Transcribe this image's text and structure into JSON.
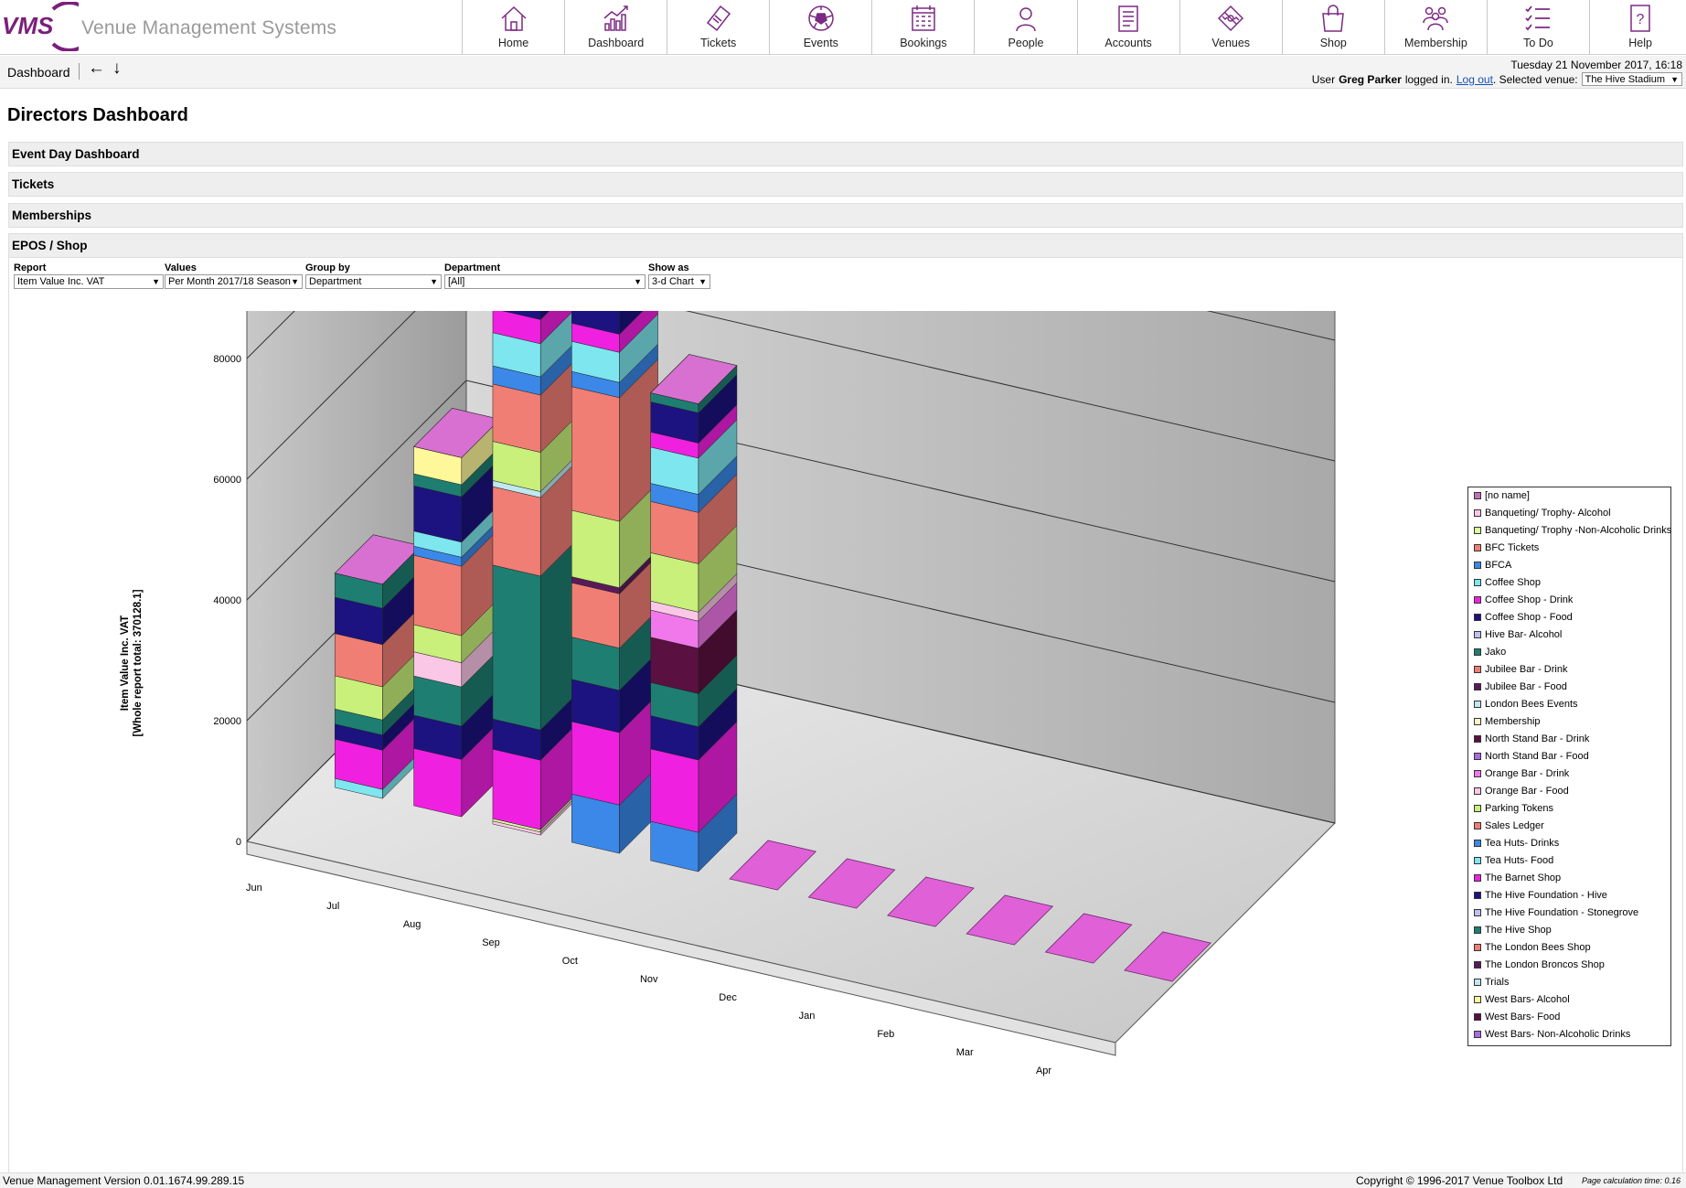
{
  "header": {
    "logo_text": "VMS",
    "title": "Venue Management Systems",
    "nav": [
      {
        "label": "Home",
        "icon": "home-icon"
      },
      {
        "label": "Dashboard",
        "icon": "dashboard-chart-icon"
      },
      {
        "label": "Tickets",
        "icon": "ticket-icon"
      },
      {
        "label": "Events",
        "icon": "football-icon"
      },
      {
        "label": "Bookings",
        "icon": "calendar-icon"
      },
      {
        "label": "People",
        "icon": "person-icon"
      },
      {
        "label": "Accounts",
        "icon": "document-icon"
      },
      {
        "label": "Venues",
        "icon": "pitch-icon"
      },
      {
        "label": "Shop",
        "icon": "shopping-bag-icon"
      },
      {
        "label": "Membership",
        "icon": "group-icon"
      },
      {
        "label": "To Do",
        "icon": "checklist-icon"
      },
      {
        "label": "Help",
        "icon": "help-icon"
      }
    ]
  },
  "crumbbar": {
    "breadcrumb": "Dashboard",
    "back": "←",
    "down": "↓",
    "datetime": "Tuesday 21 November 2017, 16:18",
    "user_prefix": "User",
    "user_name": "Greg Parker",
    "logged_in": "logged in.",
    "logout": "Log out",
    "venue_prefix": ". Selected venue:",
    "venue": "The Hive Stadium",
    "dropdown_arrow": "▼"
  },
  "page": {
    "title": "Directors Dashboard",
    "sections": [
      "Event Day Dashboard",
      "Tickets",
      "Memberships",
      "EPOS / Shop"
    ]
  },
  "filters": [
    {
      "label": "Report",
      "value": "Item Value Inc. VAT"
    },
    {
      "label": "Values",
      "value": "Per Month 2017/18 Season"
    },
    {
      "label": "Group by",
      "value": "Department"
    },
    {
      "label": "Department",
      "value": "[All]"
    },
    {
      "label": "Show as",
      "value": "3-d Chart"
    }
  ],
  "chart_data": {
    "type": "bar",
    "stacked": true,
    "three_d": true,
    "ylabel": "Item Value Inc. VAT",
    "ylabel2": "[Whole report total: 370128.1]",
    "ylim": [
      0,
      100000
    ],
    "yticks": [
      "0",
      "20000",
      "40000",
      "60000",
      "80000",
      "100000"
    ],
    "categories": [
      "Jun",
      "Jul",
      "Aug",
      "Sep",
      "Oct",
      "Nov",
      "Dec",
      "Jan",
      "Feb",
      "Mar",
      "Apr"
    ],
    "grid": true,
    "legend_position": "right",
    "series": [
      {
        "name": "[no name]",
        "color": "#c070b8",
        "values": [
          0,
          0,
          0,
          0,
          0,
          0,
          0,
          0,
          0,
          0,
          0
        ]
      },
      {
        "name": "Banqueting/ Trophy- Alcohol",
        "color": "#fbc7e6",
        "values": [
          0,
          0,
          500,
          0,
          0,
          0,
          0,
          0,
          0,
          0,
          0
        ]
      },
      {
        "name": "Banqueting/ Trophy -Non-Alcoholic Drinks",
        "color": "#d8ff9c",
        "values": [
          0,
          0,
          400,
          0,
          0,
          0,
          0,
          0,
          0,
          0,
          0
        ]
      },
      {
        "name": "BFC Tickets",
        "color": "#f07e74",
        "values": [
          0,
          0,
          0,
          0,
          0,
          0,
          0,
          0,
          0,
          0,
          0
        ]
      },
      {
        "name": "BFCA",
        "color": "#3b88e8",
        "values": [
          0,
          0,
          0,
          8000,
          6500,
          0,
          0,
          0,
          0,
          0,
          0
        ]
      },
      {
        "name": "Coffee Shop",
        "color": "#7de6ee",
        "values": [
          1500,
          0,
          0,
          0,
          0,
          0,
          0,
          0,
          0,
          0,
          0
        ]
      },
      {
        "name": "Coffee Shop - Drink",
        "color": "#f020e0",
        "values": [
          6500,
          9500,
          11500,
          12000,
          12000,
          0,
          0,
          0,
          0,
          0,
          0
        ]
      },
      {
        "name": "Coffee Shop - Food",
        "color": "#1c1280",
        "values": [
          2500,
          5500,
          5000,
          7000,
          5500,
          0,
          0,
          0,
          0,
          0,
          0
        ]
      },
      {
        "name": "Hive Bar- Alcohol",
        "color": "#c0c0ec",
        "values": [
          0,
          0,
          0,
          0,
          0,
          0,
          0,
          0,
          0,
          0,
          0
        ]
      },
      {
        "name": "Jako",
        "color": "#1e7e72",
        "values": [
          2500,
          6500,
          25500,
          7000,
          5500,
          0,
          0,
          0,
          0,
          0,
          0
        ]
      },
      {
        "name": "Jubilee Bar - Drink",
        "color": "#f07e74",
        "values": [
          0,
          0,
          13000,
          9000,
          0,
          0,
          0,
          0,
          0,
          0,
          0
        ]
      },
      {
        "name": "Jubilee Bar - Food",
        "color": "#5a1a5a",
        "values": [
          0,
          0,
          0,
          1000,
          0,
          0,
          0,
          0,
          0,
          0,
          0
        ]
      },
      {
        "name": "London Bees Events",
        "color": "#c0e8f0",
        "values": [
          0,
          0,
          1000,
          0,
          0,
          0,
          0,
          0,
          0,
          0,
          0
        ]
      },
      {
        "name": "Membership",
        "color": "#fff4c8",
        "values": [
          0,
          0,
          0,
          0,
          0,
          0,
          0,
          0,
          0,
          0,
          0
        ]
      },
      {
        "name": "North Stand Bar - Drink",
        "color": "#5a1040",
        "values": [
          0,
          0,
          0,
          0,
          7500,
          0,
          0,
          0,
          0,
          0,
          0
        ]
      },
      {
        "name": "North Stand Bar - Food",
        "color": "#a86ce0",
        "values": [
          0,
          0,
          0,
          0,
          0,
          0,
          0,
          0,
          0,
          0,
          0
        ]
      },
      {
        "name": "Orange Bar - Drink",
        "color": "#f078ea",
        "values": [
          0,
          0,
          0,
          0,
          4500,
          0,
          0,
          0,
          0,
          0,
          0
        ]
      },
      {
        "name": "Orange Bar - Food",
        "color": "#fbc7e6",
        "values": [
          0,
          4000,
          0,
          0,
          1500,
          0,
          0,
          0,
          0,
          0,
          0
        ]
      },
      {
        "name": "Parking Tokens",
        "color": "#c8f07a",
        "values": [
          5500,
          4500,
          6500,
          11000,
          8000,
          0,
          0,
          0,
          0,
          0,
          0
        ]
      },
      {
        "name": "Sales Ledger",
        "color": "#f07e74",
        "values": [
          7000,
          11500,
          9500,
          20500,
          8500,
          0,
          0,
          0,
          0,
          0,
          0
        ]
      },
      {
        "name": "Tea Huts- Drinks",
        "color": "#3b88e8",
        "values": [
          0,
          1500,
          3000,
          2500,
          3000,
          0,
          0,
          0,
          0,
          0,
          0
        ]
      },
      {
        "name": "Tea Huts- Food",
        "color": "#7de6ee",
        "values": [
          0,
          2500,
          5500,
          5000,
          6000,
          0,
          0,
          0,
          0,
          0,
          0
        ]
      },
      {
        "name": "The Barnet Shop",
        "color": "#f020e0",
        "values": [
          0,
          0,
          4000,
          3000,
          2500,
          0,
          0,
          0,
          0,
          0,
          0
        ]
      },
      {
        "name": "The Hive Foundation - Hive",
        "color": "#1c1280",
        "values": [
          6000,
          7500,
          7000,
          5000,
          5000,
          0,
          0,
          0,
          0,
          0,
          0
        ]
      },
      {
        "name": "The Hive Foundation - Stonegrove",
        "color": "#c0c0ec",
        "values": [
          0,
          0,
          0,
          0,
          0,
          0,
          0,
          0,
          0,
          0,
          0
        ]
      },
      {
        "name": "The Hive Shop",
        "color": "#1e7e72",
        "values": [
          4000,
          2000,
          6500,
          2500,
          1500,
          0,
          0,
          0,
          0,
          0,
          0
        ]
      },
      {
        "name": "The London Bees Shop",
        "color": "#f07e74",
        "values": [
          0,
          0,
          0,
          0,
          0,
          0,
          0,
          0,
          0,
          0,
          0
        ]
      },
      {
        "name": "The London Broncos Shop",
        "color": "#5a1a5a",
        "values": [
          0,
          0,
          0,
          0,
          0,
          0,
          0,
          0,
          0,
          0,
          0
        ]
      },
      {
        "name": "Trials",
        "color": "#c0e8f0",
        "values": [
          0,
          0,
          0,
          0,
          0,
          0,
          0,
          0,
          0,
          0,
          0
        ]
      },
      {
        "name": "West Bars- Alcohol",
        "color": "#fff89a",
        "values": [
          0,
          4500,
          0,
          0,
          0,
          0,
          0,
          0,
          0,
          0,
          0
        ]
      },
      {
        "name": "West Bars- Food",
        "color": "#5a1040",
        "values": [
          0,
          0,
          0,
          0,
          0,
          0,
          0,
          0,
          0,
          0,
          0
        ]
      },
      {
        "name": "West Bars- Non-Alcoholic Drinks",
        "color": "#a86ce0",
        "values": [
          0,
          0,
          0,
          0,
          0,
          0,
          0,
          0,
          0,
          0,
          0
        ]
      }
    ]
  },
  "footer": {
    "version": "Venue Management Version 0.01.1674.99.289.15",
    "copyright": "Copyright © 1996-2017 Venue Toolbox Ltd",
    "calc": "Page calculation time: 0.16"
  }
}
